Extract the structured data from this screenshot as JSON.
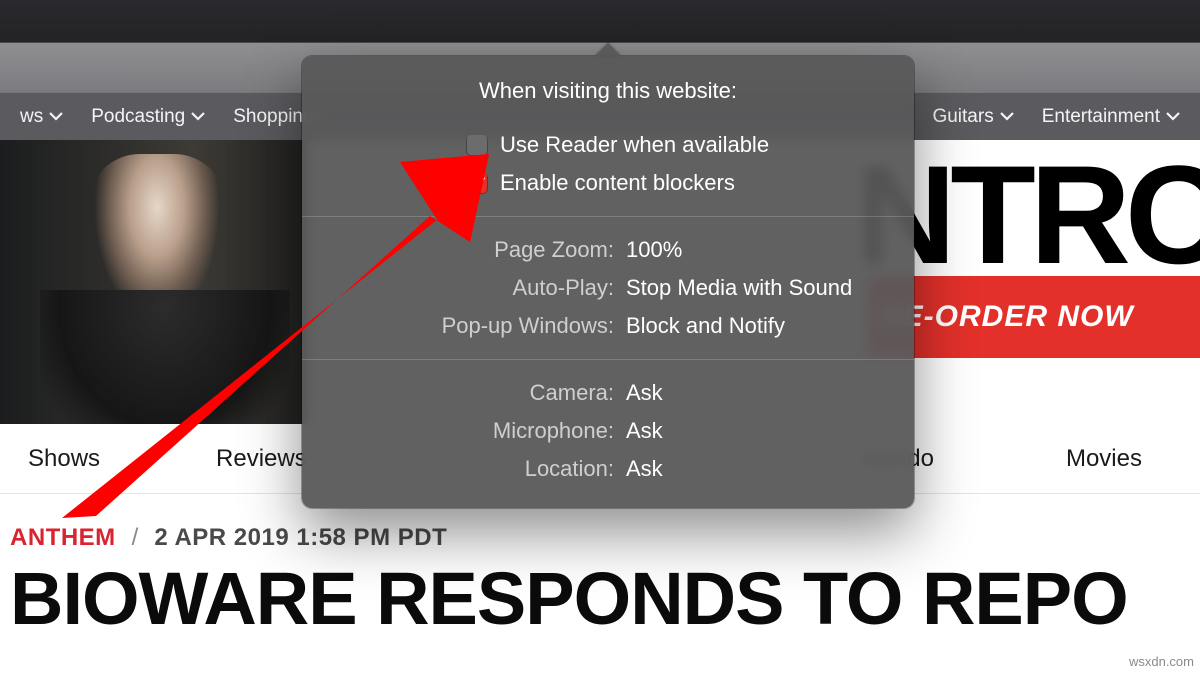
{
  "nav_top": {
    "items": [
      "ws",
      "Podcasting",
      "Shopping",
      "Guitars",
      "Entertainment"
    ]
  },
  "hero": {
    "ntro_text": "NTRC",
    "preorder_label": "RE-ORDER NOW"
  },
  "nav_sub": {
    "items": [
      "Shows",
      "Reviews",
      "ntendo",
      "Movies"
    ]
  },
  "article": {
    "category": "ANTHEM",
    "date": "2 APR 2019 1:58 PM PDT",
    "headline": "BIOWARE RESPONDS TO REPO"
  },
  "popover": {
    "title": "When visiting this website:",
    "use_reader_label": "Use Reader when available",
    "use_reader_checked": false,
    "content_blockers_label": "Enable content blockers",
    "content_blockers_checked": true,
    "page_zoom_label": "Page Zoom:",
    "page_zoom_value": "100%",
    "auto_play_label": "Auto-Play:",
    "auto_play_value": "Stop Media with Sound",
    "popup_label": "Pop-up Windows:",
    "popup_value": "Block and Notify",
    "camera_label": "Camera:",
    "camera_value": "Ask",
    "microphone_label": "Microphone:",
    "microphone_value": "Ask",
    "location_label": "Location:",
    "location_value": "Ask"
  },
  "watermark": "wsxdn.com"
}
